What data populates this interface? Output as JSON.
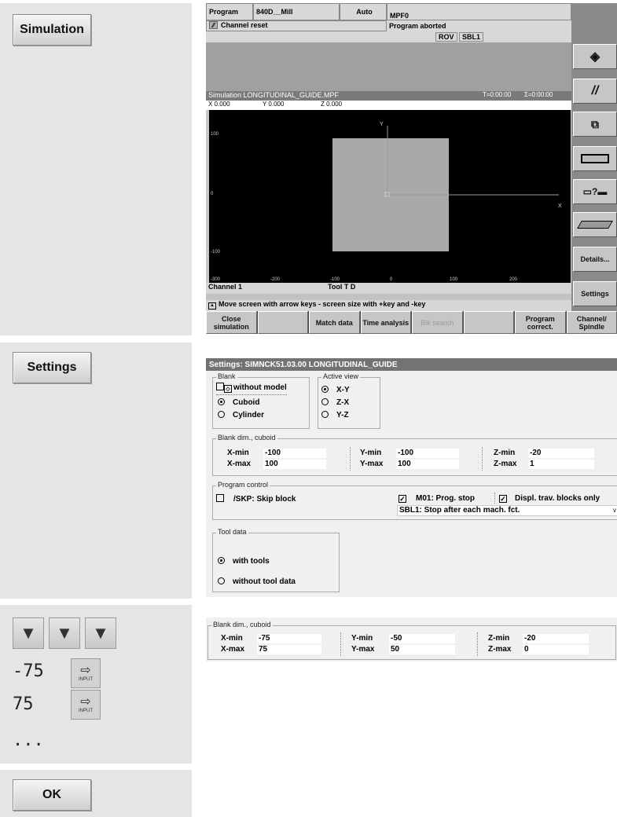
{
  "left_steps": {
    "simulation_label": "Simulation",
    "settings_label": "Settings",
    "ok_label": "OK",
    "value_min": "-75",
    "value_max": "75",
    "ellipsis": "...",
    "input_label": "INPUT"
  },
  "screen1": {
    "program_label": "Program",
    "machine": "840D__Mill",
    "mode": "Auto",
    "program_name": "MPF0",
    "channel_status": "Channel reset",
    "program_status": "Program aborted",
    "flag_rov": "ROV",
    "flag_sbl": "SBL1",
    "sim_title": "Simulation  LONGITUDINAL_GUIDE.MPF",
    "time_t": "T=0:00:00",
    "time_sigma": "Σ=0:00:00",
    "coord_x": "X   0.000",
    "coord_y": "Y   0.000",
    "coord_z": "Z   0.000",
    "canvas": {
      "y_axis_label": "Y",
      "x_axis_label": "X",
      "y_ticks": [
        "100",
        "0",
        "-100"
      ],
      "x_ticks": [
        "-300",
        "-200",
        "-100",
        "0",
        "100",
        "200"
      ]
    },
    "channel_label": "Channel 1",
    "tool_label": "Tool T  D",
    "hint": "Move screen with arrow keys -  screen size with +key and -key",
    "softkeys": [
      "Close simulation",
      "",
      "Match data",
      "Time analysis",
      "Blk search",
      "",
      "Program correct.",
      "Channel/ Spindle"
    ],
    "side_keys": {
      "details": "Details...",
      "settings": "Settings"
    }
  },
  "screen2": {
    "title": "Settings:  SIMNCK51.03.00   LONGITUDINAL_GUIDE",
    "blank_legend": "Blank",
    "without_model": "without model",
    "cuboid": "Cuboid",
    "cylinder": "Cylinder",
    "active_view_legend": "Active view",
    "view_xy": "X-Y",
    "view_zx": "Z-X",
    "view_yz": "Y-Z",
    "blank_dim_legend": "Blank dim., cuboid",
    "xmin_label": "X-min",
    "xmin": "-100",
    "xmax_label": "X-max",
    "xmax": "100",
    "ymin_label": "Y-min",
    "ymin": "-100",
    "ymax_label": "Y-max",
    "ymax": "100",
    "zmin_label": "Z-min",
    "zmin": "-20",
    "zmax_label": "Z-max",
    "zmax": "1",
    "program_control_legend": "Program control",
    "skip_block": "/SKP: Skip block",
    "m01": "M01: Prog. stop",
    "displ_trav": "Displ. trav. blocks only",
    "sbl_option": "SBL1: Stop after each mach. fct.",
    "tool_data_legend": "Tool data",
    "with_tools": "with tools",
    "without_tool_data": "without tool data"
  },
  "screen3": {
    "blank_dim_legend": "Blank dim., cuboid",
    "xmin_label": "X-min",
    "xmin": "-75",
    "xmax_label": "X-max",
    "xmax": "75",
    "ymin_label": "Y-min",
    "ymin": "-50",
    "ymax_label": "Y-max",
    "ymax": "50",
    "zmin_label": "Z-min",
    "zmin": "-20",
    "zmax_label": "Z-max",
    "zmax": "0"
  }
}
